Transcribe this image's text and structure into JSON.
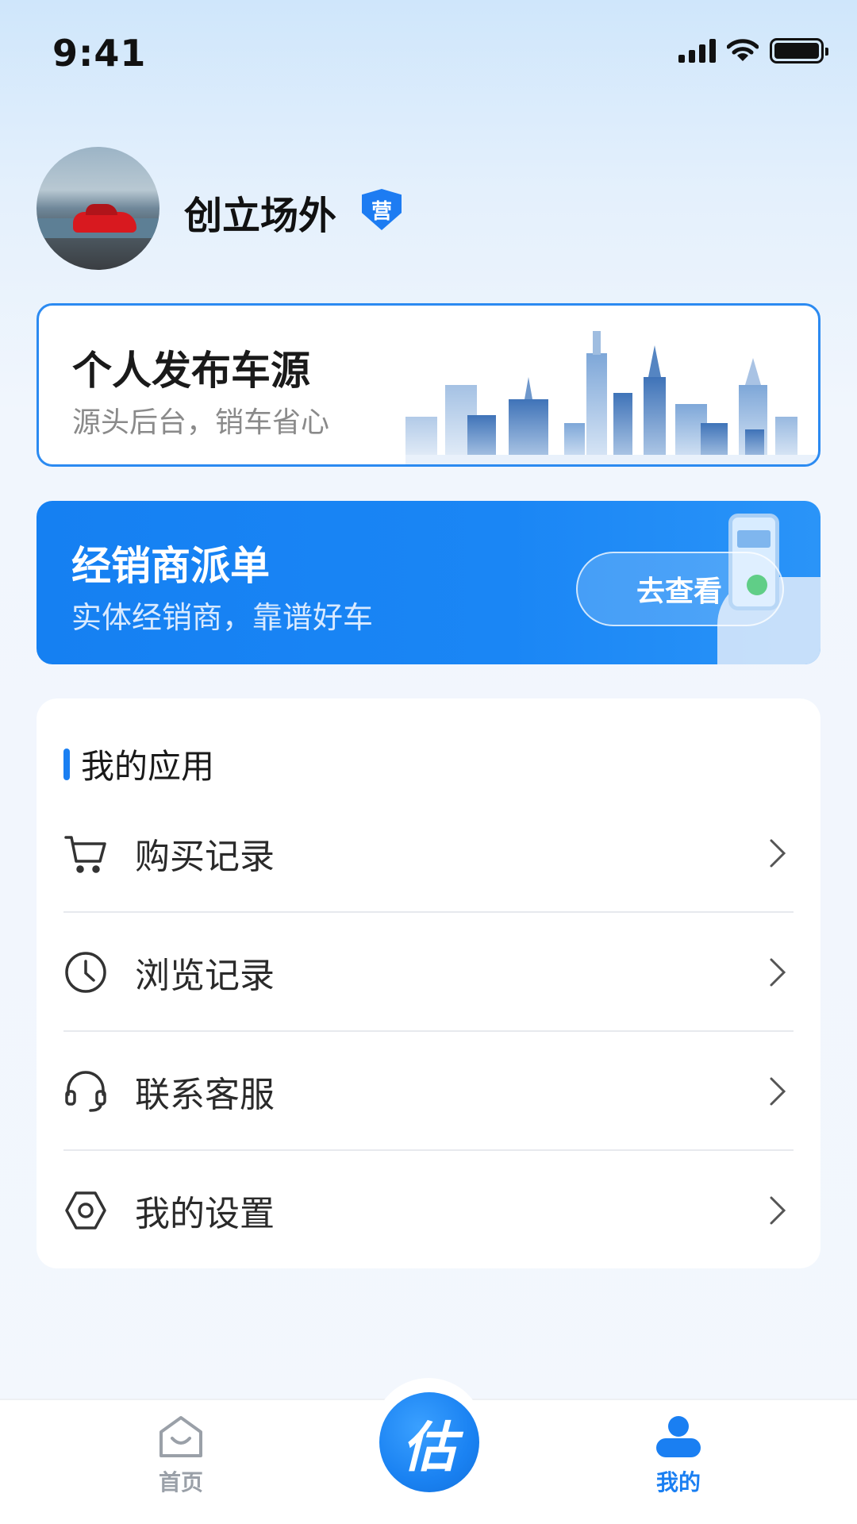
{
  "status_bar": {
    "time": "9:41"
  },
  "profile": {
    "name": "创立场外",
    "badge": "营"
  },
  "publish_card": {
    "title": "个人发布车源",
    "subtitle": "源头后台，销车省心"
  },
  "dealer_card": {
    "title": "经销商派单",
    "subtitle": "实体经销商，靠谱好车",
    "button": "去查看"
  },
  "apps": {
    "title": "我的应用",
    "items": [
      {
        "label": "购买记录",
        "icon": "cart-icon"
      },
      {
        "label": "浏览记录",
        "icon": "clock-icon"
      },
      {
        "label": "联系客服",
        "icon": "headset-icon"
      },
      {
        "label": "我的设置",
        "icon": "settings-icon"
      }
    ]
  },
  "tab_bar": {
    "home_label": "首页",
    "center_label": "估",
    "mine_label": "我的"
  },
  "colors": {
    "accent": "#1a7ff2",
    "inactive": "#9aa0a8"
  }
}
